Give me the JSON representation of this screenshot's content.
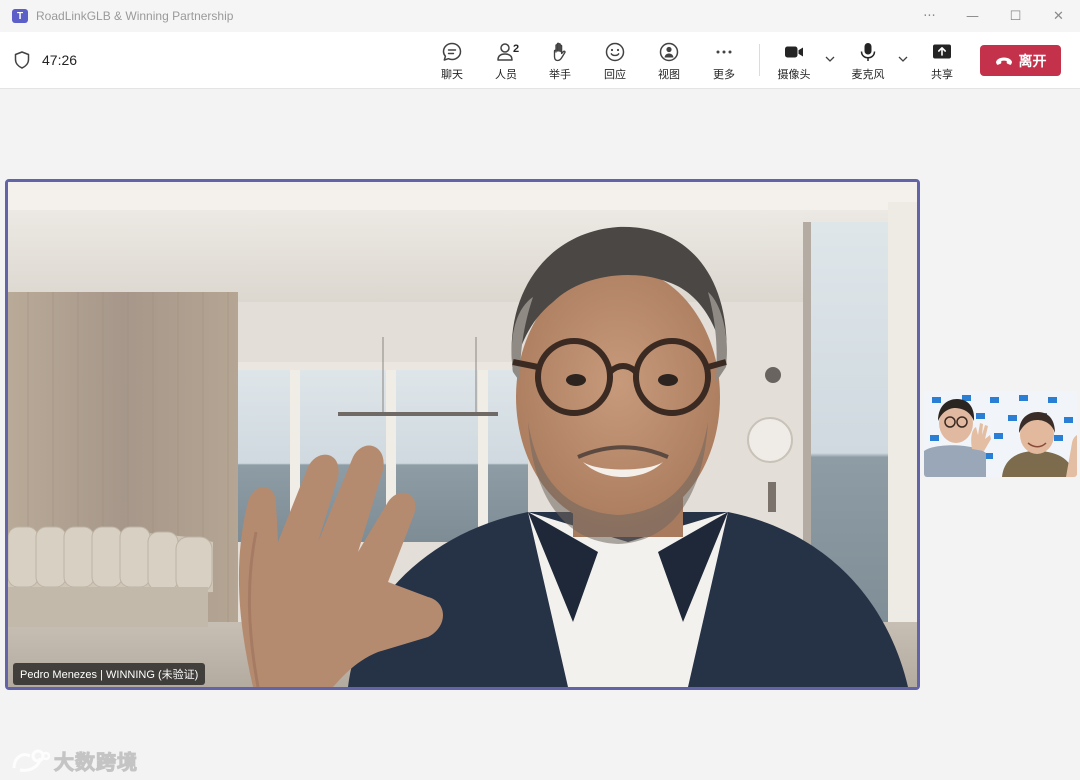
{
  "window": {
    "title": "RoadLinkGLB & Winning Partnership",
    "logo_text": "T",
    "controls": {
      "more": "···",
      "minimize": "—",
      "maximize": "☐",
      "close": "✕"
    }
  },
  "toolbar": {
    "timer": "47:26",
    "items": [
      {
        "id": "chat",
        "label": "聊天",
        "icon": "chat-icon"
      },
      {
        "id": "people",
        "label": "人员",
        "icon": "people-icon",
        "count": "2"
      },
      {
        "id": "raise-hand",
        "label": "举手",
        "icon": "hand-icon"
      },
      {
        "id": "react",
        "label": "回应",
        "icon": "smiley-icon"
      },
      {
        "id": "view",
        "label": "视图",
        "icon": "view-icon"
      },
      {
        "id": "more",
        "label": "更多",
        "icon": "more-icon"
      },
      {
        "id": "camera",
        "label": "摄像头",
        "icon": "camera-icon"
      },
      {
        "id": "mic",
        "label": "麦克风",
        "icon": "microphone-icon"
      },
      {
        "id": "share",
        "label": "共享",
        "icon": "share-icon"
      }
    ],
    "leave_label": "离开"
  },
  "stage": {
    "participant_name": "Pedro Menezes | WINNING (未验证)"
  },
  "watermark": {
    "text": "大数跨境"
  },
  "colors": {
    "accent": "#6264a7",
    "leave": "#c4314b",
    "brand": "#5b5fc7"
  }
}
